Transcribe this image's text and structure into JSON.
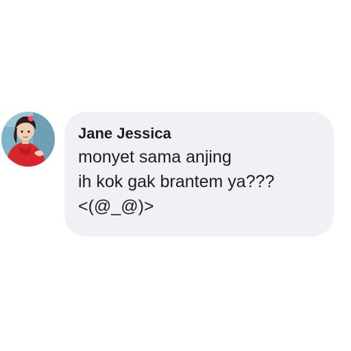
{
  "comment": {
    "author": "Jane Jessica",
    "lines": [
      "monyet sama anjing",
      "ih kok gak brantem ya???",
      "<(@_@)>"
    ],
    "avatar_icon": "profile-photo-child-red-dress"
  },
  "colors": {
    "bubble_background": "#eff1f4",
    "text": "#1c1e21",
    "page_background": "#ffffff"
  }
}
